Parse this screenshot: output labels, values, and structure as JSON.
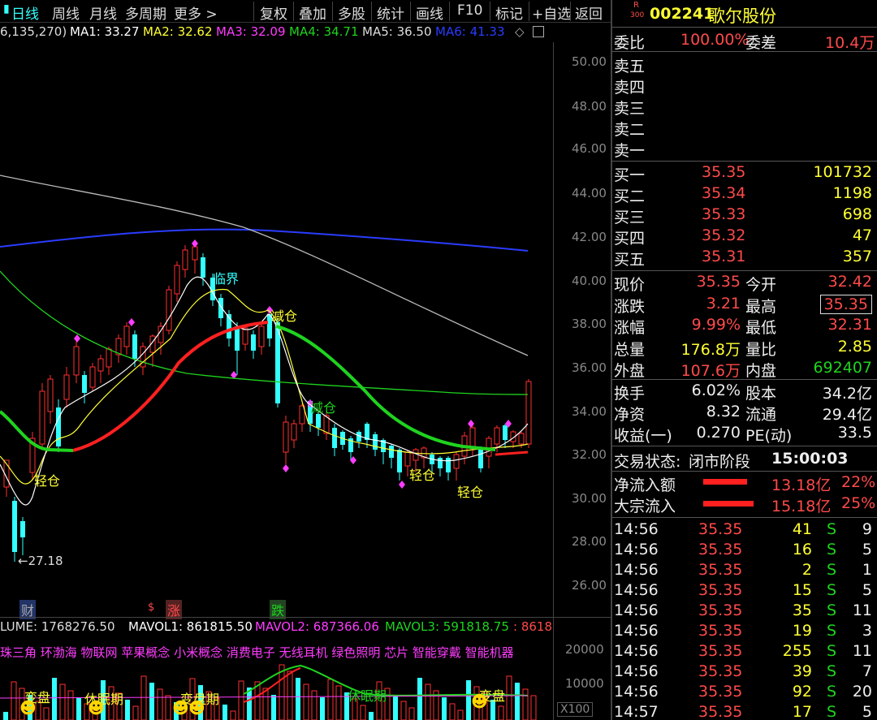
{
  "toolbar": {
    "left_items": [
      "日线",
      "周线",
      "月线",
      "多周期",
      "更多 >"
    ],
    "right_items": [
      "复权",
      "叠加",
      "多股",
      "统计",
      "画线",
      "F10",
      "标记",
      "+自选",
      "返回"
    ]
  },
  "ma_row": {
    "prefix": "6,135,270)",
    "ma1": "MA1: 33.27",
    "ma2": "MA2: 32.62",
    "ma3": "MA3: 32.09",
    "ma4": "MA4: 34.71",
    "ma5": "MA5: 36.50",
    "ma6": "MA6: 41.33"
  },
  "price_axis": [
    "50.00",
    "48.00",
    "46.00",
    "44.00",
    "42.00",
    "40.00",
    "38.00",
    "36.00",
    "34.00",
    "32.00",
    "30.00",
    "28.00",
    "26.00"
  ],
  "chart_labels": {
    "low_price": "←27.18",
    "signal_edge": "临界",
    "signal_reduce": "减仓",
    "signal_light_1": "轻仓",
    "signal_light_2": "轻仓",
    "signal_light_3": "轻仓",
    "signal_reduce_2": "减仓",
    "event_cai": "财",
    "event_zhang": "涨",
    "event_die": "跌"
  },
  "volume_row": {
    "volume": "LUME: 1768276.50",
    "mavol1": "MAVOL1: 861815.50",
    "mavol2": "MAVOL2: 687366.06",
    "mavol3": "MAVOL3: 591818.75",
    "extra": ": 8618"
  },
  "concepts": "珠三角 环渤海 物联网 苹果概念 小米概念 消费电子 无线耳机 绿色照明 芯片 智能穿戴 智能机器",
  "volume_axis": [
    "20000",
    "10000"
  ],
  "volume_unit": "X100",
  "volume_labels": {
    "l1": "变盘",
    "l2": "休眠期",
    "l3": "变盘期",
    "l4": "休眠期",
    "l5": "变盘"
  },
  "quote": {
    "badge_top": "R",
    "badge_bottom": "300",
    "code": "002241",
    "name": "歌尔股份",
    "weibi_label": "委比",
    "weibi_value": "100.00%",
    "weicha_label": "委差",
    "weicha_value": "10.4万",
    "sell": [
      {
        "label": "卖五",
        "price": "",
        "vol": ""
      },
      {
        "label": "卖四",
        "price": "",
        "vol": ""
      },
      {
        "label": "卖三",
        "price": "",
        "vol": ""
      },
      {
        "label": "卖二",
        "price": "",
        "vol": ""
      },
      {
        "label": "卖一",
        "price": "",
        "vol": ""
      }
    ],
    "buy": [
      {
        "label": "买一",
        "price": "35.35",
        "vol": "101732"
      },
      {
        "label": "买二",
        "price": "35.34",
        "vol": "1198"
      },
      {
        "label": "买三",
        "price": "35.33",
        "vol": "698"
      },
      {
        "label": "买四",
        "price": "35.32",
        "vol": "47"
      },
      {
        "label": "买五",
        "price": "35.31",
        "vol": "357"
      }
    ],
    "stats": [
      {
        "l1": "现价",
        "v1": "35.35",
        "l2": "今开",
        "v2": "32.42"
      },
      {
        "l1": "涨跌",
        "v1": "3.21",
        "l2": "最高",
        "v2": "35.35"
      },
      {
        "l1": "涨幅",
        "v1": "9.99%",
        "l2": "最低",
        "v2": "32.31"
      },
      {
        "l1": "总量",
        "v1": "176.8万",
        "l2": "量比",
        "v2": "2.85"
      },
      {
        "l1": "外盘",
        "v1": "107.6万",
        "l2": "内盘",
        "v2": "692407"
      }
    ],
    "fund": [
      {
        "l1": "换手",
        "v1": "6.02%",
        "l2": "股本",
        "v2": "34.2亿"
      },
      {
        "l1": "净资",
        "v1": "8.32",
        "l2": "流通",
        "v2": "29.4亿"
      },
      {
        "l1": "收益(一)",
        "v1": "0.270",
        "l2": "PE(动)",
        "v2": "33.5"
      }
    ],
    "status_label": "交易状态:",
    "status_value": "闭市阶段",
    "status_time": "15:00:03",
    "net_inflow_label": "净流入额",
    "net_inflow_value": "13.18亿",
    "net_inflow_pct": "22%",
    "block_inflow_label": "大宗流入",
    "block_inflow_value": "15.18亿",
    "block_inflow_pct": "25%",
    "ticks": [
      {
        "time": "14:56",
        "price": "35.35",
        "vol": "41",
        "side": "S",
        "n": "9"
      },
      {
        "time": "14:56",
        "price": "35.35",
        "vol": "16",
        "side": "S",
        "n": "5"
      },
      {
        "time": "14:56",
        "price": "35.35",
        "vol": "2",
        "side": "S",
        "n": "1"
      },
      {
        "time": "14:56",
        "price": "35.35",
        "vol": "15",
        "side": "S",
        "n": "5"
      },
      {
        "time": "14:56",
        "price": "35.35",
        "vol": "35",
        "side": "S",
        "n": "11"
      },
      {
        "time": "14:56",
        "price": "35.35",
        "vol": "19",
        "side": "S",
        "n": "3"
      },
      {
        "time": "14:56",
        "price": "35.35",
        "vol": "255",
        "side": "S",
        "n": "11"
      },
      {
        "time": "14:56",
        "price": "35.35",
        "vol": "39",
        "side": "S",
        "n": "7"
      },
      {
        "time": "14:56",
        "price": "35.35",
        "vol": "92",
        "side": "S",
        "n": "20"
      },
      {
        "time": "14:57",
        "price": "35.35",
        "vol": "17",
        "side": "S",
        "n": "5"
      }
    ]
  },
  "colors": {
    "up": "#ff4a4a",
    "down": "#33ffff",
    "ma1": "#ffffff",
    "ma2": "#ffff33",
    "ma3": "#ff3cff",
    "ma4": "#1fd31f",
    "ma5": "#dddddd",
    "ma6": "#2a3cff"
  }
}
